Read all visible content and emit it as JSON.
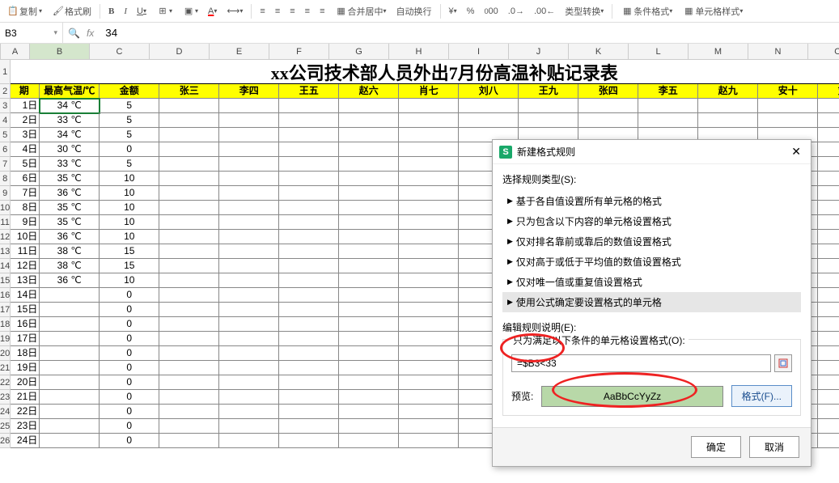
{
  "toolbar": {
    "copy": "复制",
    "format_painter": "格式刷",
    "merge_center": "合并居中",
    "wrap": "自动换行",
    "type_convert": "类型转换",
    "cond_fmt": "条件格式",
    "cell_style": "单元格样式"
  },
  "formula_bar": {
    "name_box": "B3",
    "formula": "34"
  },
  "columns": [
    "A",
    "B",
    "C",
    "D",
    "E",
    "F",
    "G",
    "H",
    "I",
    "J",
    "K",
    "L",
    "M",
    "N",
    "O"
  ],
  "col_widths": {
    "A": 36,
    "B": 74,
    "others": 74
  },
  "title": "xx公司技术部人员外出7月份高温补贴记录表",
  "header_row": [
    "期",
    "最高气温/℃",
    "金额",
    "张三",
    "李四",
    "王五",
    "赵六",
    "肖七",
    "刘八",
    "王九",
    "张四",
    "李五",
    "赵九",
    "安十",
    "刘〤"
  ],
  "rows": [
    {
      "date": "1日",
      "temp": "34 ℃",
      "amount": "5"
    },
    {
      "date": "2日",
      "temp": "33 ℃",
      "amount": "5"
    },
    {
      "date": "3日",
      "temp": "34 ℃",
      "amount": "5"
    },
    {
      "date": "4日",
      "temp": "30 ℃",
      "amount": "0"
    },
    {
      "date": "5日",
      "temp": "33 ℃",
      "amount": "5"
    },
    {
      "date": "6日",
      "temp": "35 ℃",
      "amount": "10"
    },
    {
      "date": "7日",
      "temp": "36 ℃",
      "amount": "10"
    },
    {
      "date": "8日",
      "temp": "35 ℃",
      "amount": "10"
    },
    {
      "date": "9日",
      "temp": "35 ℃",
      "amount": "10"
    },
    {
      "date": "10日",
      "temp": "36 ℃",
      "amount": "10"
    },
    {
      "date": "11日",
      "temp": "38 ℃",
      "amount": "15"
    },
    {
      "date": "12日",
      "temp": "38 ℃",
      "amount": "15"
    },
    {
      "date": "13日",
      "temp": "36 ℃",
      "amount": "10"
    },
    {
      "date": "14日",
      "temp": "",
      "amount": "0"
    },
    {
      "date": "15日",
      "temp": "",
      "amount": "0"
    },
    {
      "date": "16日",
      "temp": "",
      "amount": "0"
    },
    {
      "date": "17日",
      "temp": "",
      "amount": "0"
    },
    {
      "date": "18日",
      "temp": "",
      "amount": "0"
    },
    {
      "date": "19日",
      "temp": "",
      "amount": "0"
    },
    {
      "date": "20日",
      "temp": "",
      "amount": "0"
    },
    {
      "date": "21日",
      "temp": "",
      "amount": "0"
    },
    {
      "date": "22日",
      "temp": "",
      "amount": "0"
    },
    {
      "date": "23日",
      "temp": "",
      "amount": "0"
    },
    {
      "date": "24日",
      "temp": "",
      "amount": "0"
    }
  ],
  "dialog": {
    "title": "新建格式规则",
    "rule_type_label": "选择规则类型(S):",
    "rule_types": [
      "基于各自值设置所有单元格的格式",
      "只为包含以下内容的单元格设置格式",
      "仅对排名靠前或靠后的数值设置格式",
      "仅对高于或低于平均值的数值设置格式",
      "仅对唯一值或重复值设置格式",
      "使用公式确定要设置格式的单元格"
    ],
    "desc_label": "编辑规则说明(E):",
    "cond_label": "只为满足以下条件的单元格设置格式(O):",
    "formula_value": "=$B3<33",
    "preview_label": "预览:",
    "preview_sample": "AaBbCcYyZz",
    "format_btn": "格式(F)...",
    "ok": "确定",
    "cancel": "取消"
  }
}
